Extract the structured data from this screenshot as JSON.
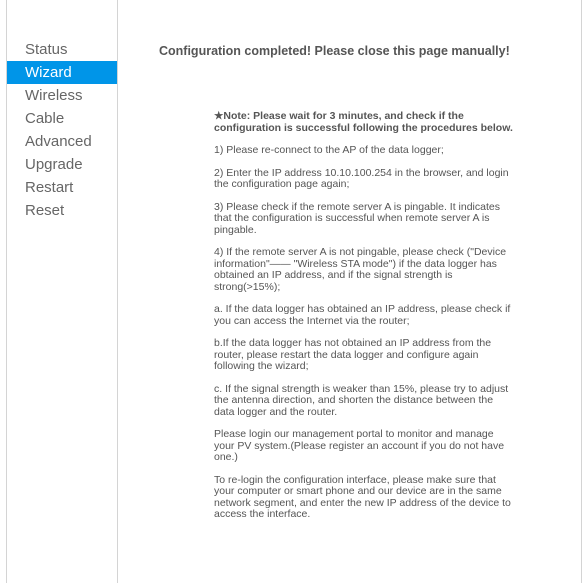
{
  "sidebar": {
    "items": [
      {
        "label": "Status",
        "active": false
      },
      {
        "label": "Wizard",
        "active": true
      },
      {
        "label": "Wireless",
        "active": false
      },
      {
        "label": "Cable",
        "active": false
      },
      {
        "label": "Advanced",
        "active": false
      },
      {
        "label": "Upgrade",
        "active": false
      },
      {
        "label": "Restart",
        "active": false
      },
      {
        "label": "Reset",
        "active": false
      }
    ]
  },
  "main": {
    "headline": "Configuration completed! Please close this page manually!",
    "note": "★Note: Please wait for 3 minutes, and check if the configuration is successful following the procedures below.",
    "steps": [
      "1) Please re-connect to the AP of the data logger;",
      "2) Enter the IP address 10.10.100.254 in the browser, and login the configuration page again;",
      "3) Please check if the remote server A is pingable. It indicates that the configuration is successful when remote server A is pingable.",
      "4) If the remote server A is not pingable, please check (\"Device information\"—— \"Wireless STA mode\") if the data logger has obtained an IP address, and if the signal strength is strong(>15%);",
      "  a. If the data logger has obtained an IP address, please check if you can access the Internet via the router;",
      "  b.If the data logger has not obtained an IP address from the router, please restart the data logger and configure again following the wizard;",
      "  c. If the signal strength is weaker than 15%, please try to adjust the antenna direction, and shorten the distance between the data logger and the router.",
      "Please login our management portal to monitor and manage your PV system.(Please register an account if you do not have one.)",
      "To re-login the configuration interface, please make sure that your computer or smart phone and our device are in the same network segment, and enter the new IP address of the device to access the interface."
    ]
  },
  "colors": {
    "accent": "#0095e8",
    "text": "#555555",
    "border": "#d4d4d4"
  }
}
